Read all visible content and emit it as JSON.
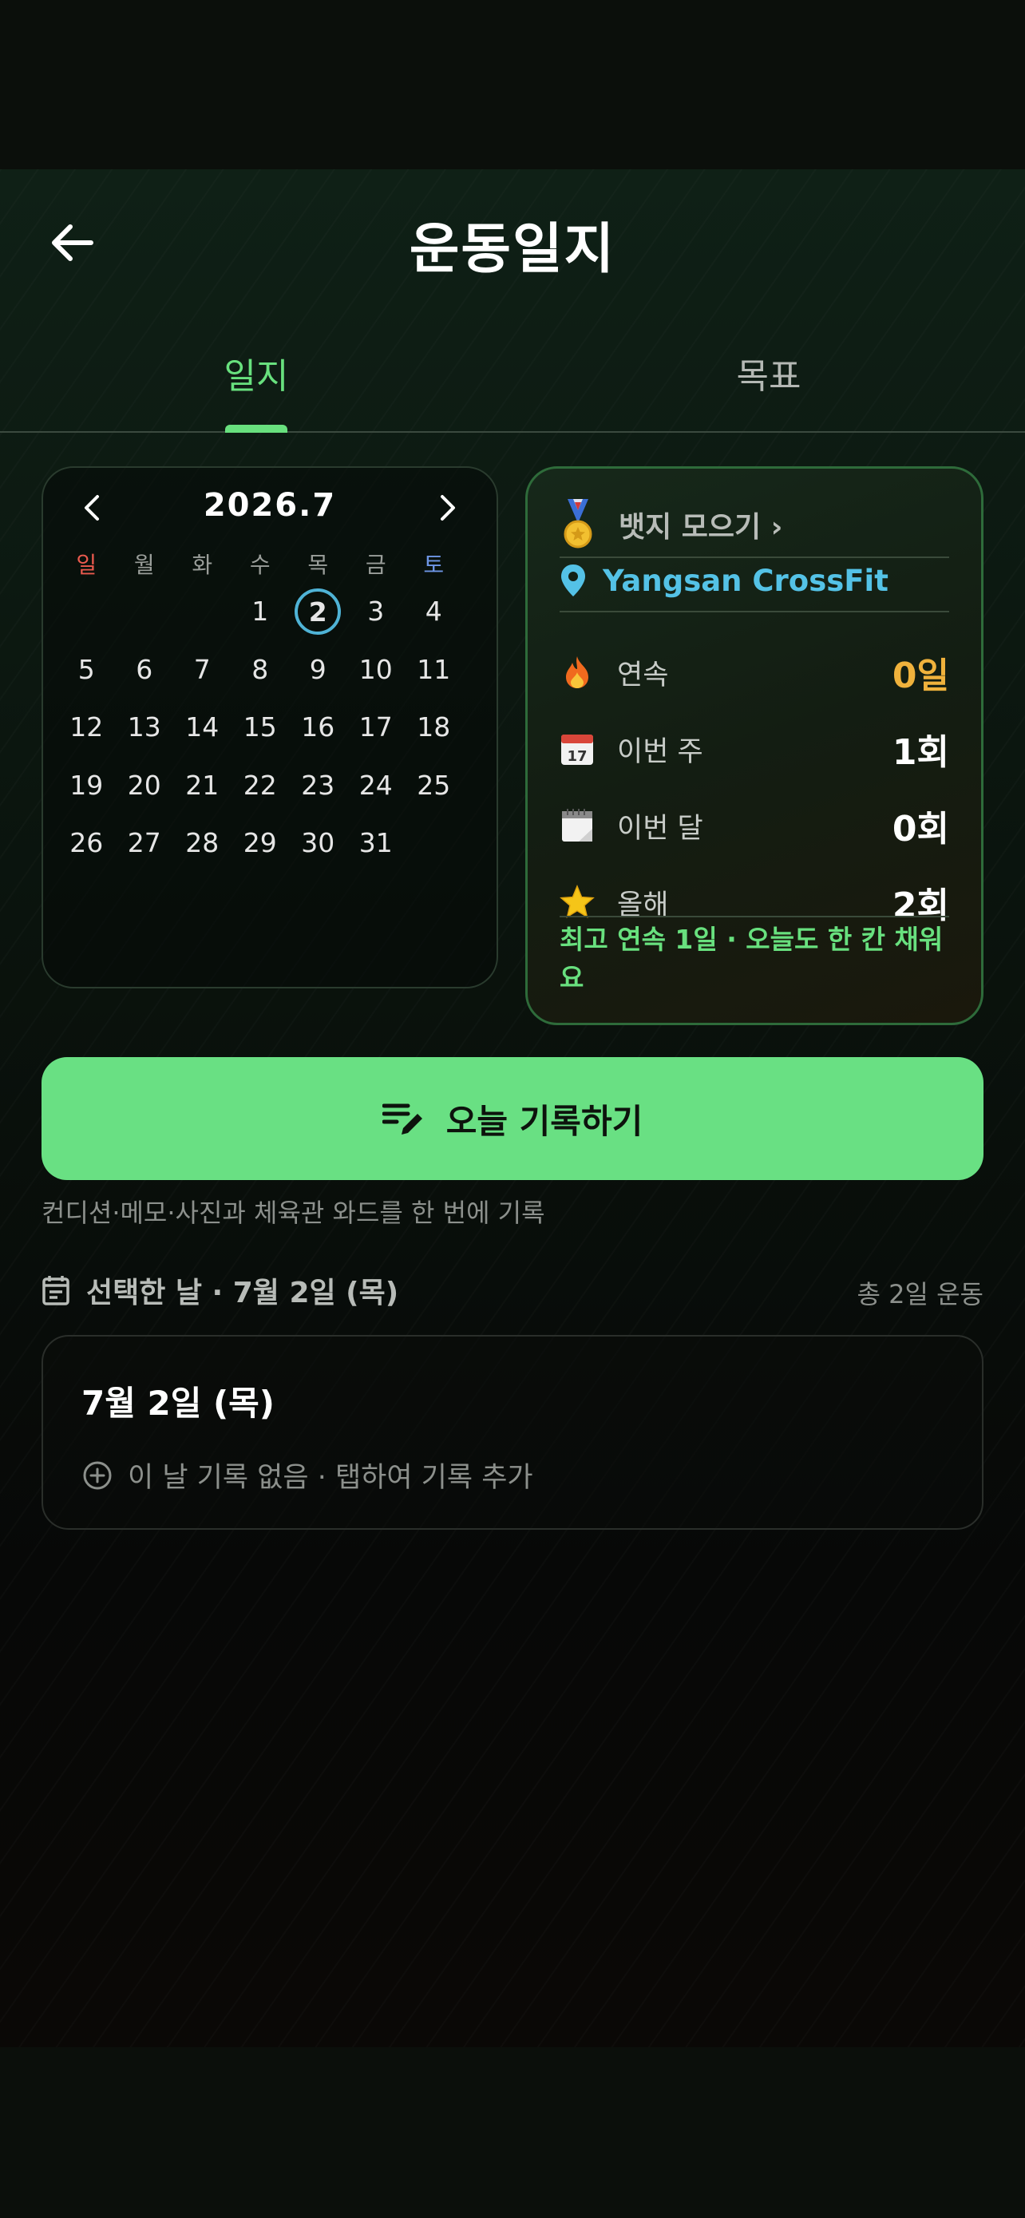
{
  "header": {
    "title": "운동일지"
  },
  "tabs": [
    {
      "label": "일지",
      "active": true
    },
    {
      "label": "목표",
      "active": false
    }
  ],
  "calendar": {
    "month_label": "2026.7",
    "weekdays": [
      "일",
      "월",
      "화",
      "수",
      "목",
      "금",
      "토"
    ],
    "weeks": [
      [
        "",
        "",
        "",
        "1",
        "2",
        "3",
        "4"
      ],
      [
        "5",
        "6",
        "7",
        "8",
        "9",
        "10",
        "11"
      ],
      [
        "12",
        "13",
        "14",
        "15",
        "16",
        "17",
        "18"
      ],
      [
        "19",
        "20",
        "21",
        "22",
        "23",
        "24",
        "25"
      ],
      [
        "26",
        "27",
        "28",
        "29",
        "30",
        "31",
        ""
      ]
    ],
    "selected_day": "2"
  },
  "stats": {
    "badge_label": "뱃지 모으기 ›",
    "gym_name": "Yangsan CrossFit",
    "rows": [
      {
        "icon": "fire-icon",
        "label": "연속",
        "value": "0일"
      },
      {
        "icon": "calendar-17-icon",
        "label": "이번 주",
        "value": "1회"
      },
      {
        "icon": "calendar-pad-icon",
        "label": "이번 달",
        "value": "0회"
      },
      {
        "icon": "star-icon",
        "label": "올해",
        "value": "2회"
      }
    ],
    "best_text": "최고 연속 1일 · 오늘도 한 칸 채워요"
  },
  "cta": {
    "label": "오늘 기록하기",
    "subtitle": "컨디션·메모·사진과 체육관 와드를 한 번에 기록"
  },
  "selected": {
    "title": "선택한 날 · 7월 2일 (목)",
    "total": "총 2일 운동",
    "card_title": "7월 2일 (목)",
    "empty_label": "이 날 기록 없음 · 탭하여 기록 추가"
  },
  "colors": {
    "accent": "#68e07e",
    "streak": "#f0b23c",
    "gym": "#54c2e6",
    "selected_ring": "#4fb3d6"
  }
}
